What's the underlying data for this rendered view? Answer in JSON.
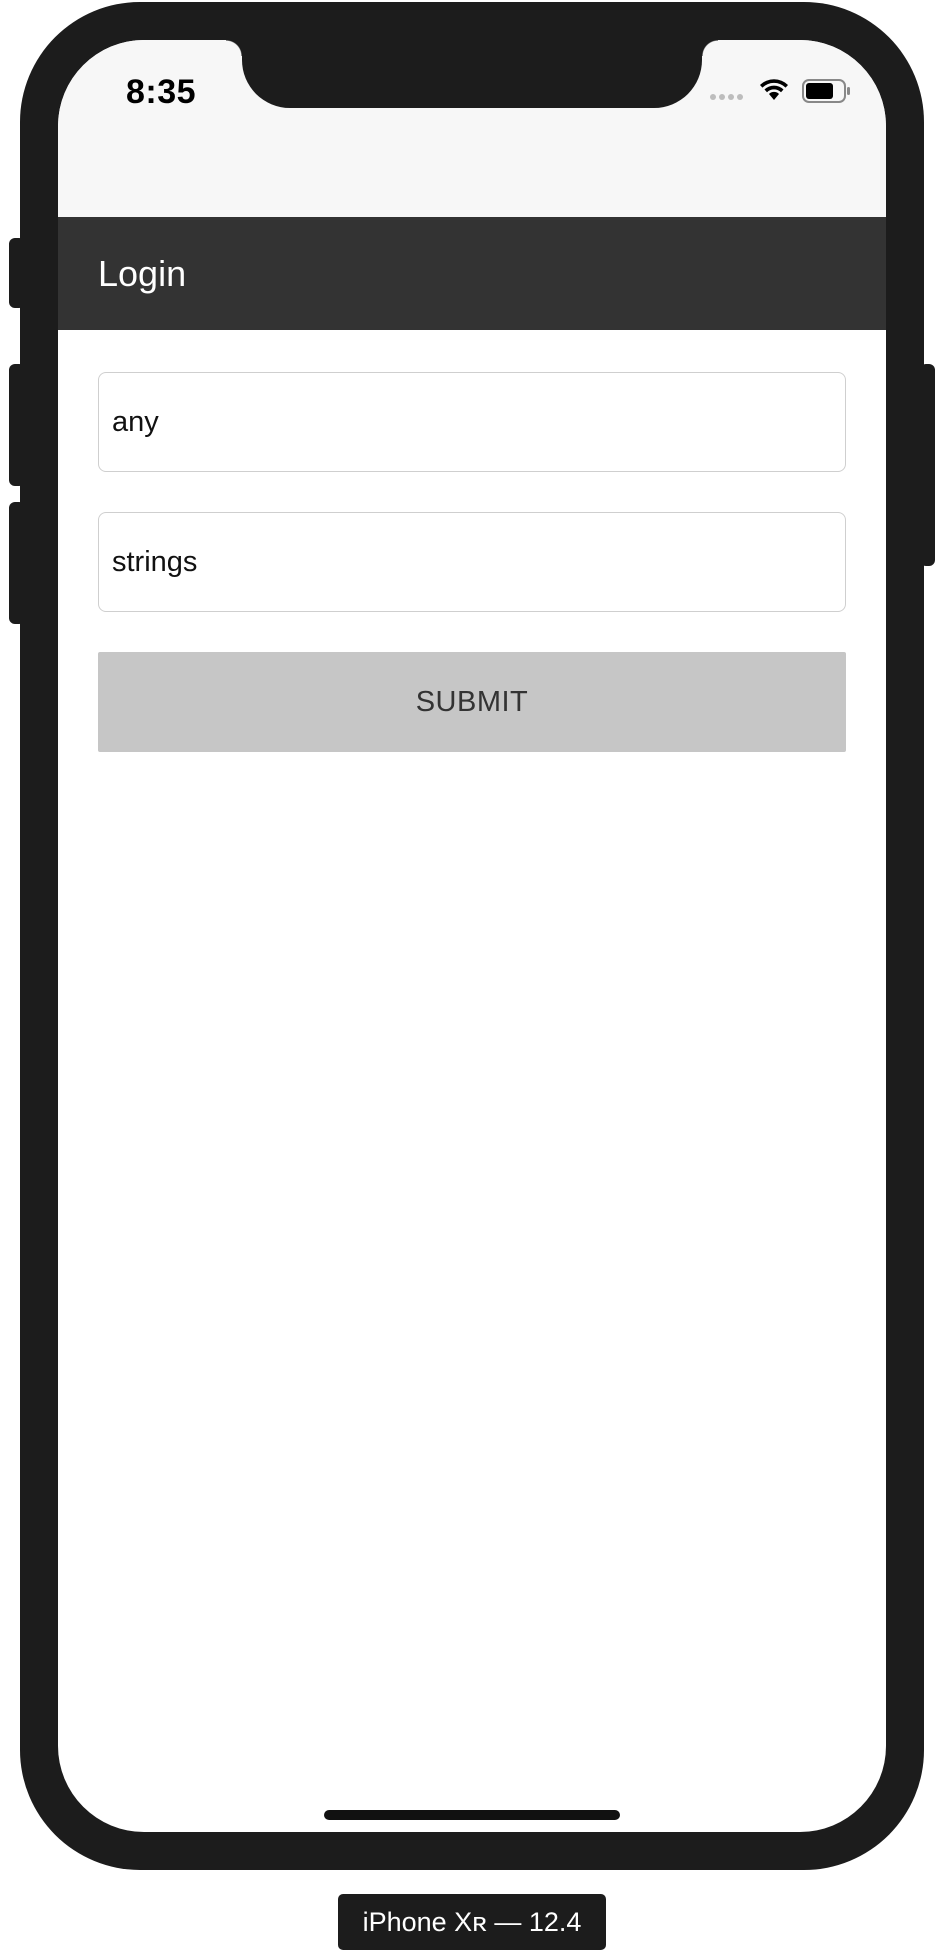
{
  "status_bar": {
    "time": "8:35",
    "icons": [
      "signal-dots-icon",
      "wifi-icon",
      "battery-icon"
    ]
  },
  "app_bar": {
    "title": "Login",
    "background": "#333333"
  },
  "form": {
    "username_value": "any",
    "password_value": "strings",
    "submit_label": "SUBMIT"
  },
  "device_label": "iPhone Xʀ — 12.4",
  "colors": {
    "app_bar": "#333333",
    "button": "#c6c6c6",
    "status_area": "#f7f7f7",
    "device_frame": "#1c1c1c"
  }
}
